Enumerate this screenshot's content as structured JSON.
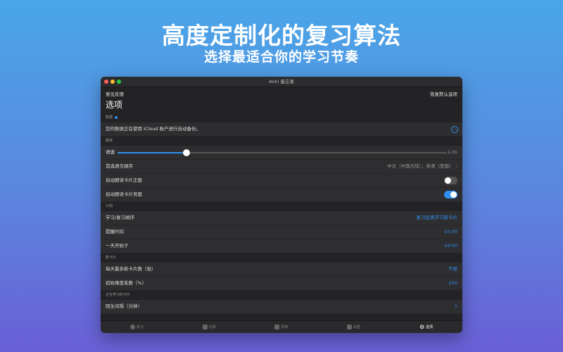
{
  "hero": {
    "title": "高度定制化的复习算法",
    "subtitle": "选择最适合你的学习节奏"
  },
  "window": {
    "title": "Anki 备忘录",
    "feedback": "意见反馈",
    "restore_defaults": "恢复默认选项",
    "page_title": "选项"
  },
  "data_section": {
    "label": "数据",
    "icloud_text": "您的数据正在使用 iCloud 账户进行自动备份。"
  },
  "reading_section": {
    "label": "朗读",
    "speed_label": "语速",
    "speed_value": "1.0x",
    "speed_level": 0.21,
    "language_label": "首选语言顺序",
    "language_value": "中文（中国大陆），英语（美国）",
    "auto_front_label": "自动朗读卡片正面",
    "auto_front_on": false,
    "auto_back_label": "自动朗读卡片背面",
    "auto_back_on": true
  },
  "plan_section": {
    "label": "计划",
    "order_label": "学习/复习顺序",
    "order_value": "复习后再学习新卡片",
    "reminder_label": "提醒时间",
    "reminder_value": "10:00",
    "day_start_label": "一天开始于",
    "day_start_value": "04:00"
  },
  "new_cards_section": {
    "label": "新卡片",
    "max_new_label": "每天最多新卡片数（张）",
    "max_new_value": "不限",
    "difficulty_label": "初始难度系数（%）",
    "difficulty_value": "250"
  },
  "learning_section": {
    "label": "正在学习的卡片",
    "interval_label": "陌生间隔（分钟）",
    "interval_value": "1"
  },
  "tabs": [
    {
      "label": "复习",
      "icon": "review-icon"
    },
    {
      "label": "记录",
      "icon": "record-icon"
    },
    {
      "label": "列表",
      "icon": "list-icon"
    },
    {
      "label": "标签",
      "icon": "tag-icon"
    },
    {
      "label": "选项",
      "icon": "gear-icon"
    }
  ],
  "colors": {
    "accent": "#2f8ff0",
    "window_bg": "#232325",
    "row_bg": "#2e2e30"
  }
}
